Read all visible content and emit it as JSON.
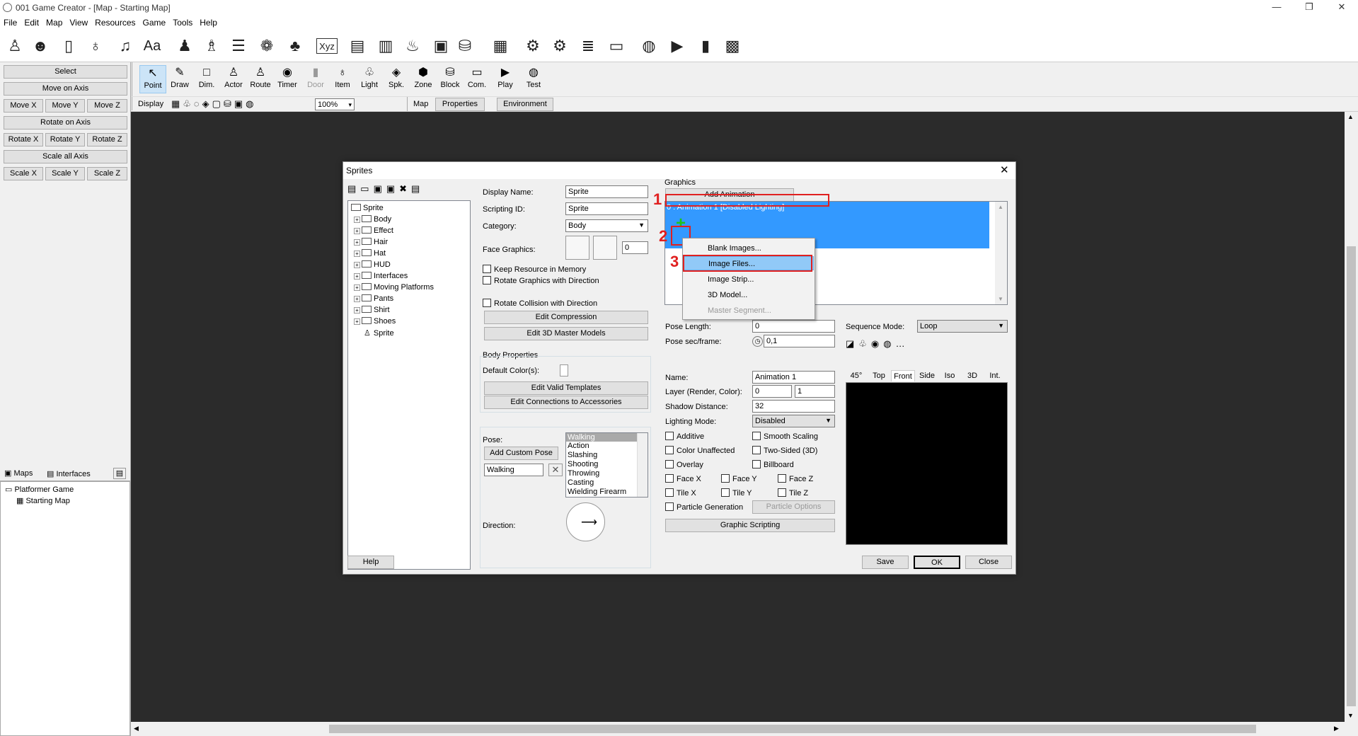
{
  "window": {
    "title": "001 Game Creator - [Map - Starting Map]",
    "min": "—",
    "max": "❐",
    "close": "✕"
  },
  "menu": [
    {
      "label": "File"
    },
    {
      "label": "Edit"
    },
    {
      "label": "Map"
    },
    {
      "label": "View"
    },
    {
      "label": "Resources"
    },
    {
      "label": "Game"
    },
    {
      "label": "Tools"
    },
    {
      "label": "Help"
    }
  ],
  "left_buttons": {
    "select": "Select",
    "move_axis": "Move on Axis",
    "move_x": "Move X",
    "move_y": "Move Y",
    "move_z": "Move Z",
    "rotate_axis": "Rotate on Axis",
    "rotate_x": "Rotate X",
    "rotate_y": "Rotate Y",
    "rotate_z": "Rotate Z",
    "scale_all": "Scale all Axis",
    "scale_x": "Scale X",
    "scale_y": "Scale Y",
    "scale_z": "Scale Z"
  },
  "map_tabs": {
    "maps": "Maps",
    "interfaces": "Interfaces"
  },
  "map_tree": {
    "root": "Platformer Game",
    "child": "Starting Map"
  },
  "tools": [
    "Point",
    "Draw",
    "Dim.",
    "Actor",
    "Route",
    "Timer",
    "Door",
    "Item",
    "Light",
    "Spk.",
    "Zone",
    "Block",
    "Com.",
    "Play",
    "Test"
  ],
  "display_bar": {
    "label": "Display",
    "zoom": "100%",
    "map": "Map",
    "properties": "Properties",
    "environment": "Environment"
  },
  "dialog": {
    "title": "Sprites",
    "tree": {
      "root": "Sprite",
      "folders": [
        "Body",
        "Effect",
        "Hair",
        "Hat",
        "HUD",
        "Interfaces",
        "Moving Platforms",
        "Pants",
        "Shirt",
        "Shoes"
      ],
      "leaf": "Sprite"
    },
    "fields": {
      "display_name_label": "Display Name:",
      "display_name": "Sprite",
      "scripting_id_label": "Scripting ID:",
      "scripting_id": "Sprite",
      "category_label": "Category:",
      "category": "Body",
      "face_graphics_label": "Face Graphics:",
      "face_graphics_value": "0"
    },
    "checks": {
      "keep_resource": "Keep Resource in Memory",
      "rotate_graphics": "Rotate Graphics with Direction",
      "rotate_collision": "Rotate Collision with Direction"
    },
    "buttons": {
      "edit_compression": "Edit Compression",
      "edit_3d_master": "Edit 3D Master Models",
      "edit_valid_templates": "Edit Valid Templates",
      "edit_connections": "Edit Connections to Accessories",
      "add_custom_pose": "Add Custom Pose",
      "help": "Help",
      "save": "Save",
      "ok": "OK",
      "close": "Close",
      "add_animation": "Add Animation",
      "graphic_scripting": "Graphic Scripting",
      "particle_options": "Particle Options"
    },
    "body_properties": {
      "heading": "Body Properties",
      "default_colors": "Default Color(s):"
    },
    "pose": {
      "label": "Pose:",
      "input": "Walking",
      "list": [
        "Walking",
        "Action",
        "Slashing",
        "Shooting",
        "Throwing",
        "Casting",
        "Wielding Firearm"
      ],
      "selected": "Walking"
    },
    "direction_label": "Direction:",
    "graphics": {
      "heading": "Graphics",
      "animation_item": "0 : Animation 1 [Disabled Lighting]"
    },
    "context_menu": [
      {
        "label": "Blank Images..."
      },
      {
        "label": "Image Files..."
      },
      {
        "label": "Image Strip..."
      },
      {
        "label": "3D Model..."
      },
      {
        "label": "Master Segment..."
      }
    ],
    "props": {
      "pose_length_label": "Pose Length:",
      "pose_length": "0",
      "pose_sec_label": "Pose sec/frame:",
      "pose_sec": "0,1",
      "name_label": "Name:",
      "name": "Animation 1",
      "layer_label": "Layer (Render, Color):",
      "layer_render": "0",
      "layer_color": "1",
      "shadow_label": "Shadow Distance:",
      "shadow": "32",
      "lighting_label": "Lighting Mode:",
      "lighting": "Disabled",
      "sequence_label": "Sequence Mode:",
      "sequence": "Loop"
    },
    "prop_checks": {
      "additive": "Additive",
      "smooth_scaling": "Smooth Scaling",
      "color_unaffected": "Color Unaffected",
      "two_sided": "Two-Sided (3D)",
      "overlay": "Overlay",
      "billboard": "Billboard",
      "face_x": "Face X",
      "face_y": "Face Y",
      "face_z": "Face Z",
      "tile_x": "Tile X",
      "tile_y": "Tile Y",
      "tile_z": "Tile Z",
      "particle_generation": "Particle Generation"
    },
    "preview_tabs": [
      "45°",
      "Top",
      "Front",
      "Side",
      "Iso",
      "3D",
      "Int."
    ],
    "preview_active": "Front",
    "annotations": [
      "1",
      "2",
      "3"
    ]
  }
}
